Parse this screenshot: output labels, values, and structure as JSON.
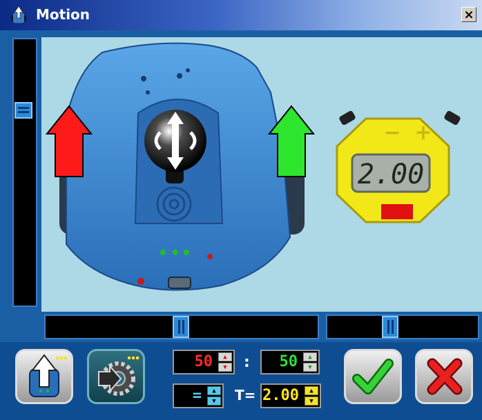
{
  "window": {
    "title": "Motion",
    "close_label": "×"
  },
  "controls": {
    "left_speed": "50",
    "right_speed": "50",
    "separator": ":",
    "mode": "=",
    "time_label": "T=",
    "time_value": "2.00"
  },
  "timer": {
    "display": "2.00",
    "minus_label": "−",
    "plus_label": "+"
  },
  "sliders": {
    "vertical_speed_level": 0.75,
    "horizontal_turn_level": 0.5,
    "horizontal_time_level": 0.4
  },
  "colors": {
    "left_arrow": "#ff1a1a",
    "right_arrow": "#2ee62e",
    "timer_body": "#f2e818",
    "scene_background": "#add8e6",
    "left_value": "#ff2a2a",
    "right_value": "#30e030",
    "mode_value": "#4ed0f0",
    "time_value": "#ffe620"
  },
  "icons": {
    "title": "robot-icon",
    "forward": "forward-arrow-icon",
    "gear": "gear-icon",
    "ok": "checkmark-icon",
    "cancel": "cancel-x-icon"
  }
}
